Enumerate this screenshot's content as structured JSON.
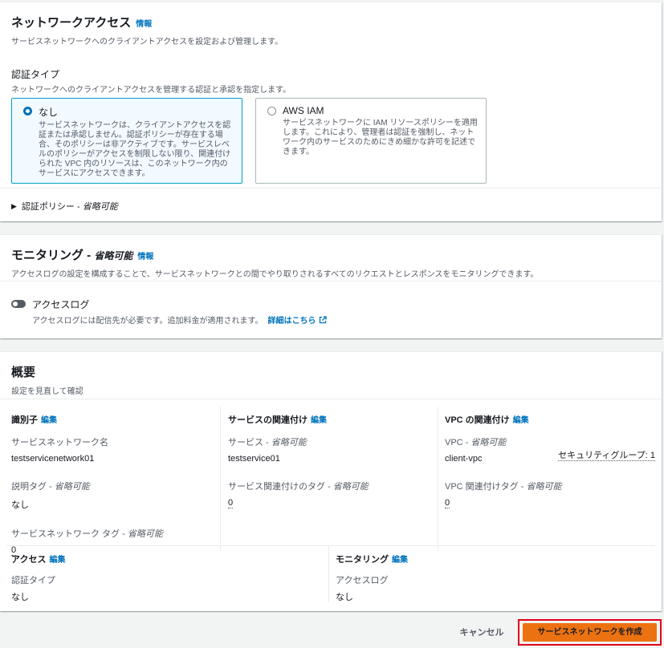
{
  "network_access": {
    "title": "ネットワークアクセス",
    "info": "情報",
    "description": "サービスネットワークへのクライアントアクセスを設定および管理します。",
    "auth_type_label": "認証タイプ",
    "auth_type_desc": "ネットワークへのクライアントアクセスを管理する認証と承認を指定します。",
    "options": [
      {
        "title": "なし",
        "text": "サービスネットワークは、クライアントアクセスを認証または承認しません。認証ポリシーが存在する場合、そのポリシーは非アクティブです。サービスレベルのポリシーがアクセスを制限しない限り、関連付けられた VPC 内のリソースは、このネットワーク内のサービスにアクセスできます。"
      },
      {
        "title": "AWS IAM",
        "text": "サービスネットワークに IAM リソースポリシーを適用します。これにより、管理者は認証を強制し、ネットワーク内のサービスのためにきめ細かな許可を記述できます。"
      }
    ],
    "auth_policy_label": "認証ポリシー - ",
    "auth_policy_opt": "省略可能"
  },
  "monitoring": {
    "title": "モニタリング - ",
    "title_opt": "省略可能",
    "info": "情報",
    "description": "アクセスログの設定を構成することで、サービスネットワークとの間でやり取りされるすべてのリクエストとレスポンスをモニタリングできます。",
    "toggle_label": "アクセスログ",
    "toggle_desc": "アクセスログには配信先が必要です。追加料金が適用されます。",
    "learn_more": "詳細はこちら"
  },
  "summary": {
    "title": "概要",
    "description": "設定を見直して確認",
    "edit": "編集",
    "identifier": {
      "title": "識別子",
      "name_label": "サービスネットワーク名",
      "name_value": "testservicenetwork01",
      "desc_tag_label": "説明タグ - ",
      "desc_tag_value": "なし",
      "sn_tag_label": "サービスネットワーク タグ - ",
      "sn_tag_value": "0"
    },
    "service_assoc": {
      "title": "サービスの関連付け",
      "service_label": "サービス - ",
      "service_value": "testservice01",
      "tag_label": "サービス関連付けのタグ - ",
      "tag_value": "0"
    },
    "vpc_assoc": {
      "title": "VPC の関連付け",
      "vpc_label": "VPC - ",
      "vpc_value": "client-vpc",
      "sg_link": "セキュリティグループ: 1",
      "tag_label": "VPC 関連付けタグ - ",
      "tag_value": "0"
    },
    "access": {
      "title": "アクセス",
      "auth_label": "認証タイプ",
      "auth_value": "なし"
    },
    "monitoring": {
      "title": "モニタリング",
      "log_label": "アクセスログ",
      "log_value": "なし"
    },
    "optional": "省略可能"
  },
  "footer": {
    "cancel": "キャンセル",
    "create": "サービスネットワークを作成"
  },
  "colors": {
    "link": "#0073bb",
    "primary_button": "#ec7211",
    "highlight_outline": "#e2001a",
    "selected_tile_border": "#00a1c9"
  }
}
